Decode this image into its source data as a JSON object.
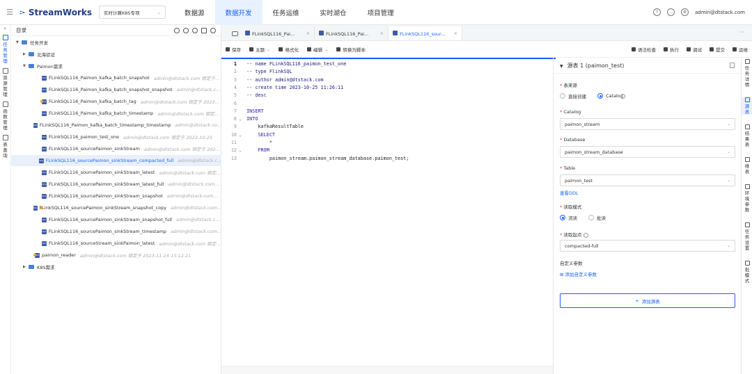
{
  "app": {
    "name": "StreamWorks",
    "project": "实时计算K8S专项",
    "user": "admin@dtstack.com"
  },
  "nav": [
    {
      "label": "数据源",
      "active": false
    },
    {
      "label": "数据开发",
      "active": true
    },
    {
      "label": "任务运维",
      "active": false
    },
    {
      "label": "实时湖仓",
      "active": false
    },
    {
      "label": "项目管理",
      "active": false
    }
  ],
  "leftbar": [
    {
      "label": "任务管理",
      "active": true,
      "icon": "task-icon"
    },
    {
      "label": "资源管理",
      "active": false,
      "icon": "resource-icon"
    },
    {
      "label": "函数管理",
      "active": false,
      "icon": "function-icon"
    },
    {
      "label": "表查询",
      "active": false,
      "icon": "table-query-icon"
    }
  ],
  "tree": {
    "title": "目录",
    "rows": [
      {
        "type": "folder",
        "level": 0,
        "open": true,
        "name": "任务开发",
        "meta": "",
        "dot": false,
        "sel": false
      },
      {
        "type": "folder",
        "level": 1,
        "open": false,
        "name": "北海验证",
        "meta": "",
        "dot": false,
        "sel": false
      },
      {
        "type": "folder",
        "level": 1,
        "open": true,
        "name": "Paimon需求",
        "meta": "",
        "dot": false,
        "sel": false
      },
      {
        "type": "file",
        "level": 2,
        "name": "FLinkSQL116_Paimon_kafka_batch_snapshot",
        "meta": "admin@dtstack.com 锁定于...",
        "dot": false,
        "sel": false
      },
      {
        "type": "file",
        "level": 2,
        "name": "FLinkSQL116_Paimon_kafka_batch_snapshot_snapshot",
        "meta": "admin@dtstack.c...",
        "dot": false,
        "sel": false
      },
      {
        "type": "file",
        "level": 2,
        "name": "FLinkSQL116_Paimon_kafka_batch_tag",
        "meta": "admin@dtstack.com 锁定于 2023...",
        "dot": true,
        "sel": false
      },
      {
        "type": "file",
        "level": 2,
        "name": "FLinkSQL116_Paimon_kafka_batch_timestamp",
        "meta": "admin@dtstack.com 锁定...",
        "dot": false,
        "sel": false
      },
      {
        "type": "file",
        "level": 2,
        "name": "FLinkSQL116_Paimon_kafka_batch_timestamp_timestamp",
        "meta": "admin@dtstack.co...",
        "dot": false,
        "sel": false
      },
      {
        "type": "file",
        "level": 2,
        "name": "FLinkSQL116_paimon_test_one",
        "meta": "admin@dtstack.com 锁定于 2023-10-25",
        "dot": false,
        "sel": false
      },
      {
        "type": "file",
        "level": 2,
        "name": "FLinkSQL116_sourcePaimon_sinkStream",
        "meta": "admin@dtstack.com 锁定于 202...",
        "dot": false,
        "sel": false
      },
      {
        "type": "file",
        "level": 2,
        "name": "FLinkSQL116_sourcePaimon_sinkStream_compacted_full",
        "meta": "admin@dtstack.c...",
        "dot": false,
        "sel": true
      },
      {
        "type": "file",
        "level": 2,
        "name": "FLinkSQL116_sourcePaimon_sinkStream_latest",
        "meta": "admin@dtstack.com 锁定...",
        "dot": false,
        "sel": false
      },
      {
        "type": "file",
        "level": 2,
        "name": "FLinkSQL116_sourcePaimon_sinkStream_latest_full",
        "meta": "admin@dtstack.com...",
        "dot": false,
        "sel": false
      },
      {
        "type": "file",
        "level": 2,
        "name": "FLinkSQL116_sourcePaimon_sinkStream_snapshot",
        "meta": "admin@dtstack.com...",
        "dot": false,
        "sel": false
      },
      {
        "type": "file",
        "level": 2,
        "name": "FLinkSQL116_sourcePaimon_sinkStream_snapshot_copy",
        "meta": "admin@dtstack.com...",
        "dot": true,
        "sel": false
      },
      {
        "type": "file",
        "level": 2,
        "name": "FLinkSQL116_sourcePaimon_sinkStream_snapshot_full",
        "meta": "admin@dtstack.c...",
        "dot": false,
        "sel": false
      },
      {
        "type": "file",
        "level": 2,
        "name": "FLinkSQL116_sourcePaimon_sinkStream_timestamp",
        "meta": "admin@dtstack.com...",
        "dot": false,
        "sel": false
      },
      {
        "type": "file",
        "level": 2,
        "name": "FLinkSQL116_sourceStream_sinkPaimon_latest",
        "meta": "admin@dtstack.com 锁定...",
        "dot": false,
        "sel": false
      },
      {
        "type": "file",
        "level": 1,
        "name": "paimon_reader",
        "meta": "admin@dtstack.com 锁定于 2023-11-14 15:12:21",
        "dot": true,
        "sel": false
      },
      {
        "type": "folder",
        "level": 1,
        "open": false,
        "name": "K8S需求",
        "meta": "",
        "dot": false,
        "sel": false
      }
    ]
  },
  "tabs": [
    {
      "label": "FLinkSQL116_Pai...",
      "active": false
    },
    {
      "label": "FLinkSQL116_Pai...",
      "active": false
    },
    {
      "label": "FLinkSQL116_sour...",
      "active": true
    }
  ],
  "toolbar": {
    "left": [
      "保存",
      "主题",
      "格式化",
      "编辑",
      "转换为脚本"
    ],
    "right": [
      "语法检查",
      "执行",
      "调试",
      "提交",
      "运维"
    ]
  },
  "code": [
    {
      "text": "-- name FLinkSQL116_paimon_test_one",
      "kind": "c",
      "fold": ""
    },
    {
      "text": "-- type FlinkSQL",
      "kind": "c",
      "fold": ""
    },
    {
      "text": "-- author admin@dtstack.com",
      "kind": "c",
      "fold": ""
    },
    {
      "text": "-- create time 2023-10-25 11:26:11",
      "kind": "c",
      "fold": ""
    },
    {
      "text": "-- desc",
      "kind": "c",
      "fold": ""
    },
    {
      "text": "",
      "kind": "t",
      "fold": ""
    },
    {
      "text": "INSERT",
      "kind": "k",
      "fold": ""
    },
    {
      "text": "INTO",
      "kind": "k",
      "fold": "v"
    },
    {
      "text": "    kafkaResultTable",
      "kind": "t",
      "fold": ""
    },
    {
      "text": "    SELECT",
      "kind": "k",
      "fold": "v"
    },
    {
      "text": "        *",
      "kind": "t",
      "fold": ""
    },
    {
      "text": "    FROM",
      "kind": "k",
      "fold": "v"
    },
    {
      "text": "        paimon_stream.paimon_stream_database.paimon_test;",
      "kind": "t",
      "fold": ""
    }
  ],
  "panel": {
    "title": "源表 1 (paimon_test)",
    "source_label": "表来源",
    "source_opts": [
      "直接创建",
      "Catalog"
    ],
    "source_sel": 1,
    "catalog_label": "Catalog",
    "catalog_val": "paimon_stream",
    "db_label": "Database",
    "db_val": "paimon_stream_database",
    "table_label": "Table",
    "table_val": "paimon_test",
    "ddl_link": "查看DDL",
    "mode_label": "读取模式",
    "mode_opts": [
      "流读",
      "批读"
    ],
    "mode_sel": 0,
    "start_label": "读取起点",
    "start_val": "compacted-full",
    "custom_label": "自定义参数",
    "custom_link": "添加自定义参数",
    "add_btn": "添加源表"
  },
  "rightbar": [
    {
      "label": "任务详情",
      "active": false
    },
    {
      "label": "源表",
      "active": true
    },
    {
      "label": "结果表",
      "active": false
    },
    {
      "label": "维表",
      "active": false
    },
    {
      "label": "环境参数",
      "active": false
    },
    {
      "label": "任务设置",
      "active": false
    },
    {
      "label": "批模式",
      "active": false
    }
  ]
}
